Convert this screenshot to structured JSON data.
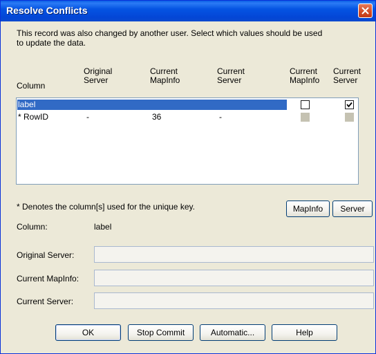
{
  "window": {
    "title": "Resolve Conflicts"
  },
  "message": {
    "line1": "This record was also changed by another user.  Select which values should be used",
    "line2": "to update the data."
  },
  "columns": {
    "column": "Column",
    "original_server": [
      "Original",
      "Server"
    ],
    "current_mapinfo": [
      "Current",
      "MapInfo"
    ],
    "current_server": [
      "Current",
      "Server"
    ],
    "cb_current_mapinfo": [
      "Current",
      "MapInfo"
    ],
    "cb_current_server": [
      "Current",
      "Server"
    ]
  },
  "rows": [
    {
      "column": "label",
      "original_server": "",
      "current_mapinfo": "",
      "current_server": "",
      "use_mapinfo": false,
      "use_server": true,
      "selected": true,
      "enabled": true
    },
    {
      "column": "* RowID",
      "original_server": "-",
      "current_mapinfo": "36",
      "current_server": "-",
      "use_mapinfo": false,
      "use_server": false,
      "selected": false,
      "enabled": false
    }
  ],
  "footnote": "* Denotes the column[s] used for the unique key.",
  "side_buttons": {
    "mapinfo": "MapInfo",
    "server": "Server"
  },
  "details": {
    "column_label": "Column:",
    "column_value": "label",
    "original_server_label": "Original Server:",
    "current_mapinfo_label": "Current MapInfo:",
    "current_server_label": "Current Server:",
    "original_server_value": "",
    "current_mapinfo_value": "",
    "current_server_value": ""
  },
  "buttons": {
    "ok": "OK",
    "stop_commit": "Stop Commit",
    "automatic": "Automatic...",
    "help": "Help"
  }
}
